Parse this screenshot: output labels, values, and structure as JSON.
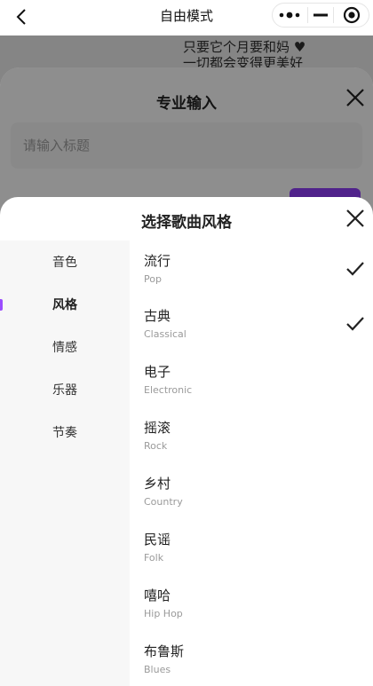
{
  "nav": {
    "title": "自由模式"
  },
  "background": {
    "lyric_line_1": "只要它个月要和妈 ♥",
    "lyric_line_2": "一切都会变得更美好"
  },
  "pro_input_modal": {
    "title": "专业输入",
    "title_placeholder": "请输入标题",
    "title_value": ""
  },
  "style_sheet": {
    "title": "选择歌曲风格",
    "accent_color": "#9b4dff",
    "categories": [
      {
        "label": "音色",
        "active": false
      },
      {
        "label": "风格",
        "active": true
      },
      {
        "label": "情感",
        "active": false
      },
      {
        "label": "乐器",
        "active": false
      },
      {
        "label": "节奏",
        "active": false
      }
    ],
    "options": [
      {
        "cn": "流行",
        "en": "Pop",
        "selected": true
      },
      {
        "cn": "古典",
        "en": "Classical",
        "selected": true
      },
      {
        "cn": "电子",
        "en": "Electronic",
        "selected": false
      },
      {
        "cn": "摇滚",
        "en": "Rock",
        "selected": false
      },
      {
        "cn": "乡村",
        "en": "Country",
        "selected": false
      },
      {
        "cn": "民谣",
        "en": "Folk",
        "selected": false
      },
      {
        "cn": "嘻哈",
        "en": "Hip Hop",
        "selected": false
      },
      {
        "cn": "布鲁斯",
        "en": "Blues",
        "selected": false
      }
    ]
  },
  "icons": {
    "back": "chevron-left-icon",
    "more": "more-dots-icon",
    "minimize": "minimize-icon",
    "capsule_close": "target-circle-icon",
    "close": "close-icon",
    "check": "check-icon"
  }
}
